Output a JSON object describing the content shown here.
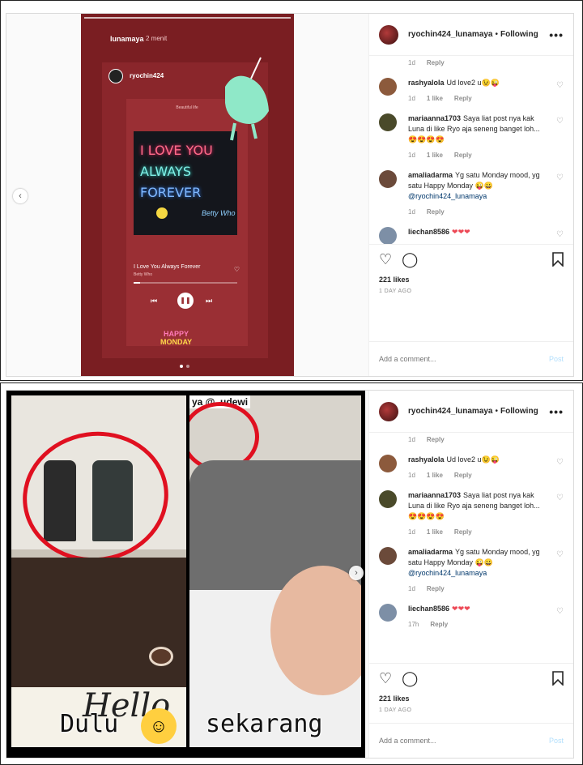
{
  "story": {
    "user": "lunamaya",
    "time": "2 menit",
    "shared_user": "ryochin424",
    "song_header": "Beautiful life",
    "neon_lines": [
      "I LOVE YOU",
      "ALWAYS",
      "FOREVER"
    ],
    "album_mark": "Betty Who",
    "song_title": "I Love You Always Forever",
    "artist": "Betty Who",
    "sticker_line1": "HAPPY",
    "sticker_line2": "MONDAY"
  },
  "meme": {
    "left_caption": "Dulu",
    "right_caption": "sekarang",
    "overlay_tag": "ya @..udewi",
    "scribble": "Hello"
  },
  "header": {
    "username": "ryochin424_lunamaya",
    "separator": "•",
    "follow_label": "Following",
    "more": "•••"
  },
  "comments_top": {
    "reply": "Reply",
    "time": "1d"
  },
  "comments": [
    {
      "user": "rashyalola",
      "text": "Ud love2 u😉😜",
      "time": "1d",
      "likes": "1 like",
      "reply": "Reply",
      "avatar_color": "#8c5a3c"
    },
    {
      "user": "mariaanna1703",
      "text": "Saya liat post nya kak Luna di like Ryo aja seneng banget loh...😍😍😍😍",
      "time": "1d",
      "likes": "1 like",
      "reply": "Reply",
      "avatar_color": "#4a4a2a"
    },
    {
      "user": "amaliadarma",
      "text": "Yg satu Monday mood, yg satu Happy Monday 😜😀",
      "mention": "@ryochin424_lunamaya",
      "time": "1d",
      "likes": "",
      "reply": "Reply",
      "avatar_color": "#6b4a3a"
    },
    {
      "user": "liechan8586",
      "text": "",
      "hearts": "❤❤❤",
      "time": "17h",
      "likes": "",
      "reply": "Reply",
      "avatar_color": "#7d8fa6"
    }
  ],
  "post1": {
    "likes": "221 likes",
    "time": "1 DAY AGO"
  },
  "post2": {
    "likes": "221 likes",
    "time": "1 DAY AGO"
  },
  "comment_box": {
    "placeholder": "Add a comment...",
    "post_label": "Post"
  },
  "icons": {
    "heart": "heart-icon",
    "comment": "comment-icon",
    "bookmark": "bookmark-icon"
  }
}
